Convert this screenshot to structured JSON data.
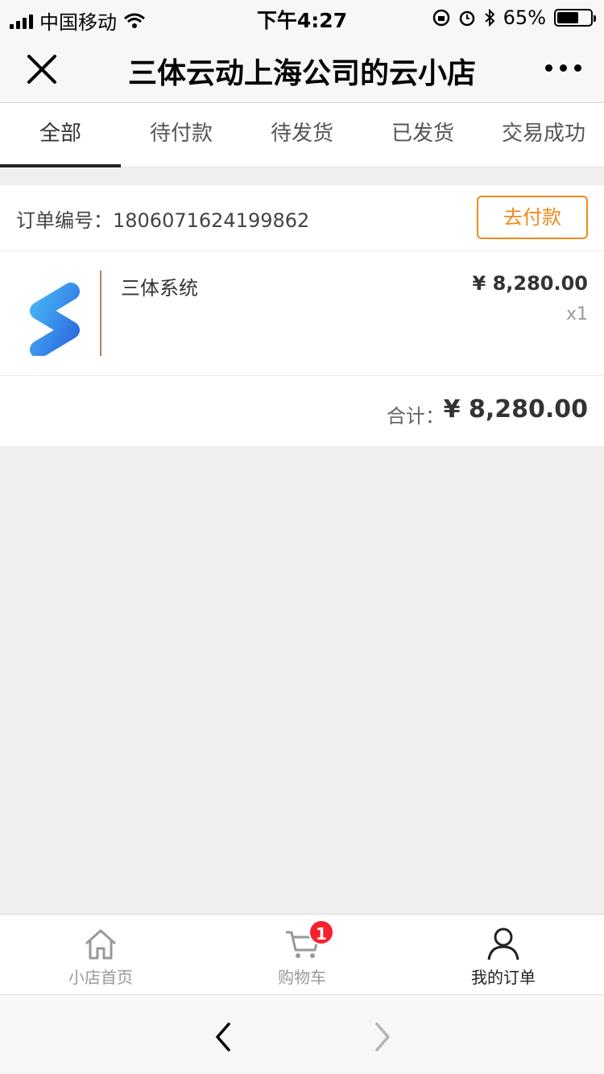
{
  "status_bar": {
    "carrier": "中国移动",
    "time": "下午4:27",
    "battery": "65%",
    "battery_level": 0.65
  },
  "nav": {
    "title": "三体云动上海公司的云小店",
    "close_icon": "close-icon",
    "more_icon": "more-dots-icon"
  },
  "tabs": [
    {
      "label": "全部",
      "active": true
    },
    {
      "label": "待付款",
      "active": false
    },
    {
      "label": "待发货",
      "active": false
    },
    {
      "label": "已发货",
      "active": false
    },
    {
      "label": "交易成功",
      "active": false
    }
  ],
  "order": {
    "number_label": "订单编号：1806071624199862",
    "pay_label": "去付款",
    "product": {
      "name": "三体系统",
      "price": "¥ 8,280.00",
      "quantity": "x1"
    },
    "total_label": "合计：",
    "total_value": "¥ 8,280.00"
  },
  "tabbar": {
    "items": [
      {
        "label": "小店首页",
        "icon": "home-icon"
      },
      {
        "label": "购物车",
        "icon": "cart-icon",
        "badge": "1"
      },
      {
        "label": "我的订单",
        "icon": "user-icon",
        "active": true
      }
    ]
  },
  "colors": {
    "accent": "#f08a1c",
    "badge": "#f5222d"
  }
}
